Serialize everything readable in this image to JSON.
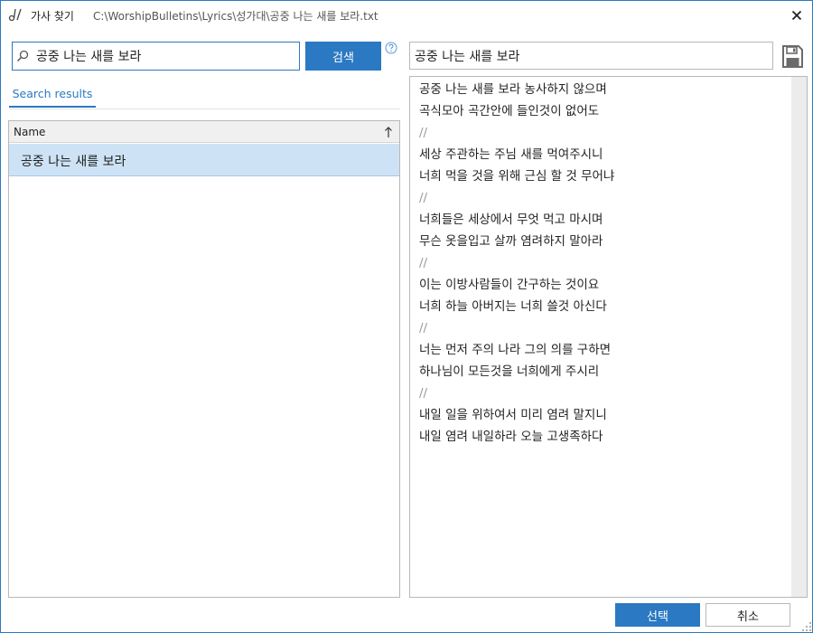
{
  "window": {
    "title": "가사 찾기",
    "path": "C:\\WorshipBulletins\\Lyrics\\성가대\\공중 나는 새를 보라.txt",
    "close_icon": "close-icon",
    "accent_color": "#2b79c2",
    "selection_color": "#cde3f5"
  },
  "search": {
    "value": "공중 나는 새를 보라",
    "placeholder": "",
    "button_label": "검색",
    "help_icon": "question-circle-icon"
  },
  "tabs": [
    {
      "label": "Search results",
      "selected": true
    }
  ],
  "results": {
    "column_name": "Name",
    "sort": "ascending",
    "rows": [
      {
        "name": "공중 나는 새를 보라",
        "selected": true
      }
    ]
  },
  "editor": {
    "title_value": "공중 나는 새를 보라",
    "save_icon": "floppy-disk-icon",
    "lines": [
      "공중 나는 새를 보라 농사하지 않으며",
      "곡식모아 곡간안에 들인것이 없어도",
      "//",
      "세상 주관하는 주님 새를 먹여주시니",
      "너희 먹을 것을 위해 근심 할 것 무어냐",
      "//",
      "너희들은 세상에서 무엇 먹고 마시며",
      "무슨 옷을입고 살까 염려하지 말아라",
      "//",
      "이는 이방사람들이 간구하는 것이요",
      "너희 하늘 아버지는 너희 쓸것 아신다",
      "//",
      "너는 먼저 주의 나라 그의 의를 구하면",
      "하나님이 모든것을 너희에게 주시리",
      "//",
      "내일 일을 위하여서 미리 염려 말지니",
      "내일 염려 내일하라 오늘 고생족하다"
    ]
  },
  "footer": {
    "ok_label": "선택",
    "cancel_label": "취소"
  }
}
